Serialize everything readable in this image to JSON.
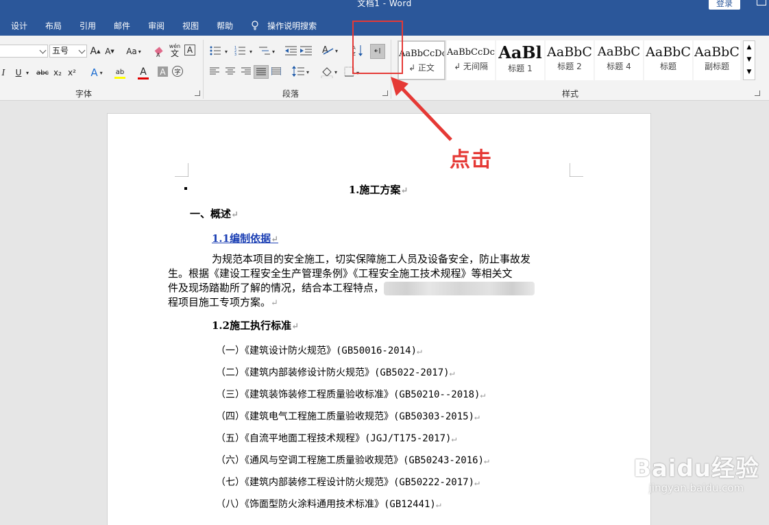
{
  "window": {
    "title": "文档1  -  Word",
    "login_label": "登录"
  },
  "tabs": [
    {
      "label": "设计"
    },
    {
      "label": "布局"
    },
    {
      "label": "引用"
    },
    {
      "label": "邮件"
    },
    {
      "label": "审阅"
    },
    {
      "label": "视图"
    },
    {
      "label": "帮助"
    }
  ],
  "tell_me": {
    "label": "操作说明搜索"
  },
  "ribbon": {
    "font_group": {
      "label": "字体",
      "font_name": "",
      "font_size": "五号",
      "grow_label": "A",
      "shrink_label": "A",
      "case_label": "Aa",
      "phonetic_top": "wén",
      "phonetic_bottom": "文",
      "border_char": "A",
      "italic": "I",
      "underline": "U",
      "strike": "abc",
      "sub": "x₂",
      "sup": "x²",
      "effects": "A",
      "highlight": "ab",
      "color": "A",
      "shade": "A",
      "enclose": "字"
    },
    "paragraph_group": {
      "label": "段落"
    },
    "styles_group": {
      "label": "样式",
      "styles": [
        {
          "sample": "AaBbCcDc",
          "name": "↲ 正文",
          "size": 13,
          "bold": false
        },
        {
          "sample": "AaBbCcDc",
          "name": "↲ 无间隔",
          "size": 13,
          "bold": false
        },
        {
          "sample": "AaBl",
          "name": "标题 1",
          "size": 24,
          "bold": true
        },
        {
          "sample": "AaBbC",
          "name": "标题 2",
          "size": 19,
          "bold": false
        },
        {
          "sample": "AaBbC",
          "name": "标题 4",
          "size": 18,
          "bold": false
        },
        {
          "sample": "AaBbC",
          "name": "标题",
          "size": 19,
          "bold": false
        },
        {
          "sample": "AaBbC",
          "name": "副标题",
          "size": 19,
          "bold": false
        }
      ]
    }
  },
  "annotation": {
    "text": "点击"
  },
  "document": {
    "title": "1.施工方案",
    "heading1": "一、概述",
    "section11": "1.1编制依据",
    "para_line1": "为规范本项目的安全施工，切实保障施工人员及设备安全，防止事故发",
    "para_line2": "生。根据《建设工程安全生产管理条例》《工程安全施工技术规程》等相关文",
    "para_line3": "件及现场踏勘所了解的情况，结合本工程特点，",
    "para_line4": "程项目施工专项方案。",
    "section12": "1.2施工执行标准",
    "standards": [
      "（一）《建筑设计防火规范》(GB50016-2014)",
      "（二）《建筑内部装修设计防火规范》(GB5022-2017)",
      "（三）《建筑装饰装修工程质量验收标准》(GB50210--2018)",
      "（四）《建筑电气工程施工质量验收规范》(GB50303-2015)",
      "（五）《自流平地面工程技术规程》(JGJ/T175-2017)",
      "（六）《通风与空调工程施工质量验收规范》(GB50243-2016)",
      "（七）《建筑内部装修工程设计防火规范》(GB50222-2017)",
      "（八）《饰面型防火涂料通用技术标准》(GB12441)"
    ],
    "para_mark": "↵"
  },
  "watermark": {
    "main": "Baidu经验",
    "sub": "jingyan.baidu.com"
  },
  "colors": {
    "title_bar": "#2b579a",
    "ribbon": "#f3f3f3",
    "annotation": "#e53935",
    "link": "#1b3fb4"
  }
}
